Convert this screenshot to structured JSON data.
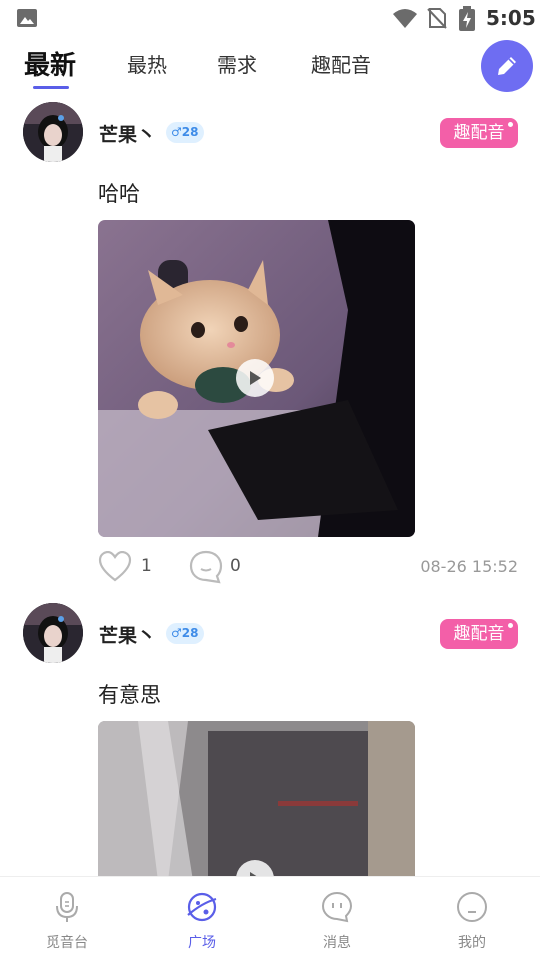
{
  "status_bar": {
    "time": "5:05",
    "icons": [
      "image-icon",
      "wifi-icon",
      "no-sim-icon",
      "battery-charging-icon"
    ]
  },
  "tabs": [
    {
      "label": "最新",
      "active": true
    },
    {
      "label": "最热",
      "active": false
    },
    {
      "label": "需求",
      "active": false
    },
    {
      "label": "趣配音",
      "active": false
    }
  ],
  "compose_button": {
    "icon": "pencil-icon"
  },
  "posts": [
    {
      "username": "芒果丶",
      "gender_badge": "♂28",
      "tag": "趣配音",
      "text": "哈哈",
      "media": {
        "type": "video",
        "description_icon": "play-icon"
      },
      "likes": "1",
      "comments": "0",
      "timestamp": "08-26 15:52"
    },
    {
      "username": "芒果丶",
      "gender_badge": "♂28",
      "tag": "趣配音",
      "text": "有意思",
      "media": {
        "type": "video",
        "description_icon": "play-icon"
      }
    }
  ],
  "bottom_nav": [
    {
      "label": "觅音台",
      "icon": "microphone-icon",
      "active": false
    },
    {
      "label": "广场",
      "icon": "planet-icon",
      "active": true
    },
    {
      "label": "消息",
      "icon": "chat-bubble-icon",
      "active": false
    },
    {
      "label": "我的",
      "icon": "face-icon",
      "active": false
    }
  ],
  "colors": {
    "accent": "#5a5ee8",
    "tag_pink": "#f35fa8",
    "badge_blue": "#3f8ce8"
  }
}
